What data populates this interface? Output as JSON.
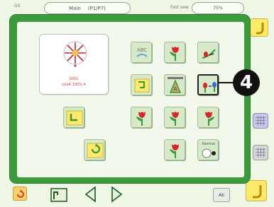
{
  "top_bar": {
    "label_left": "GS",
    "title_left": "Main",
    "title_page": "(P1/P7)",
    "label_right": "Fast sew",
    "status_value": "75%"
  },
  "preview": {
    "pattern_name": "S001",
    "pattern_size": "sizeA 100% A"
  },
  "tiles": [
    {
      "id": "tile-text",
      "icon": "abc-text-icon",
      "text": "ABC"
    },
    {
      "id": "tile-tulip-1",
      "icon": "tulip-icon"
    },
    {
      "id": "tile-bud",
      "icon": "flower-bud-icon"
    },
    {
      "id": "tile-fold",
      "icon": "fold-arrow-icon"
    },
    {
      "id": "tile-frame",
      "icon": "hoop-frame-icon",
      "text": "A"
    },
    {
      "id": "tile-color-change",
      "icon": "color-change-icon"
    },
    {
      "id": "tile-return",
      "icon": "return-arrow-icon"
    },
    {
      "id": "tile-tulip-2",
      "icon": "tulip-icon"
    },
    {
      "id": "tile-tulip-3",
      "icon": "tulip-icon"
    },
    {
      "id": "tile-tulip-4",
      "icon": "tulip-icon"
    },
    {
      "id": "tile-rotate",
      "icon": "rotate-icon"
    },
    {
      "id": "tile-tulip-5",
      "icon": "tulip-icon"
    },
    {
      "id": "tile-thread",
      "icon": "thread-spool-icon",
      "text": "Normal"
    }
  ],
  "callout": {
    "label": "4"
  },
  "bottom_bar": {
    "reset_label": "Ab"
  },
  "colors": {
    "dialog_border": "#3d9a3d",
    "tile_bg": "#d6e9c8",
    "accent_yellow": "#ffe96a",
    "flower_red": "#d8242a",
    "leaf_green": "#3a9a3a"
  }
}
